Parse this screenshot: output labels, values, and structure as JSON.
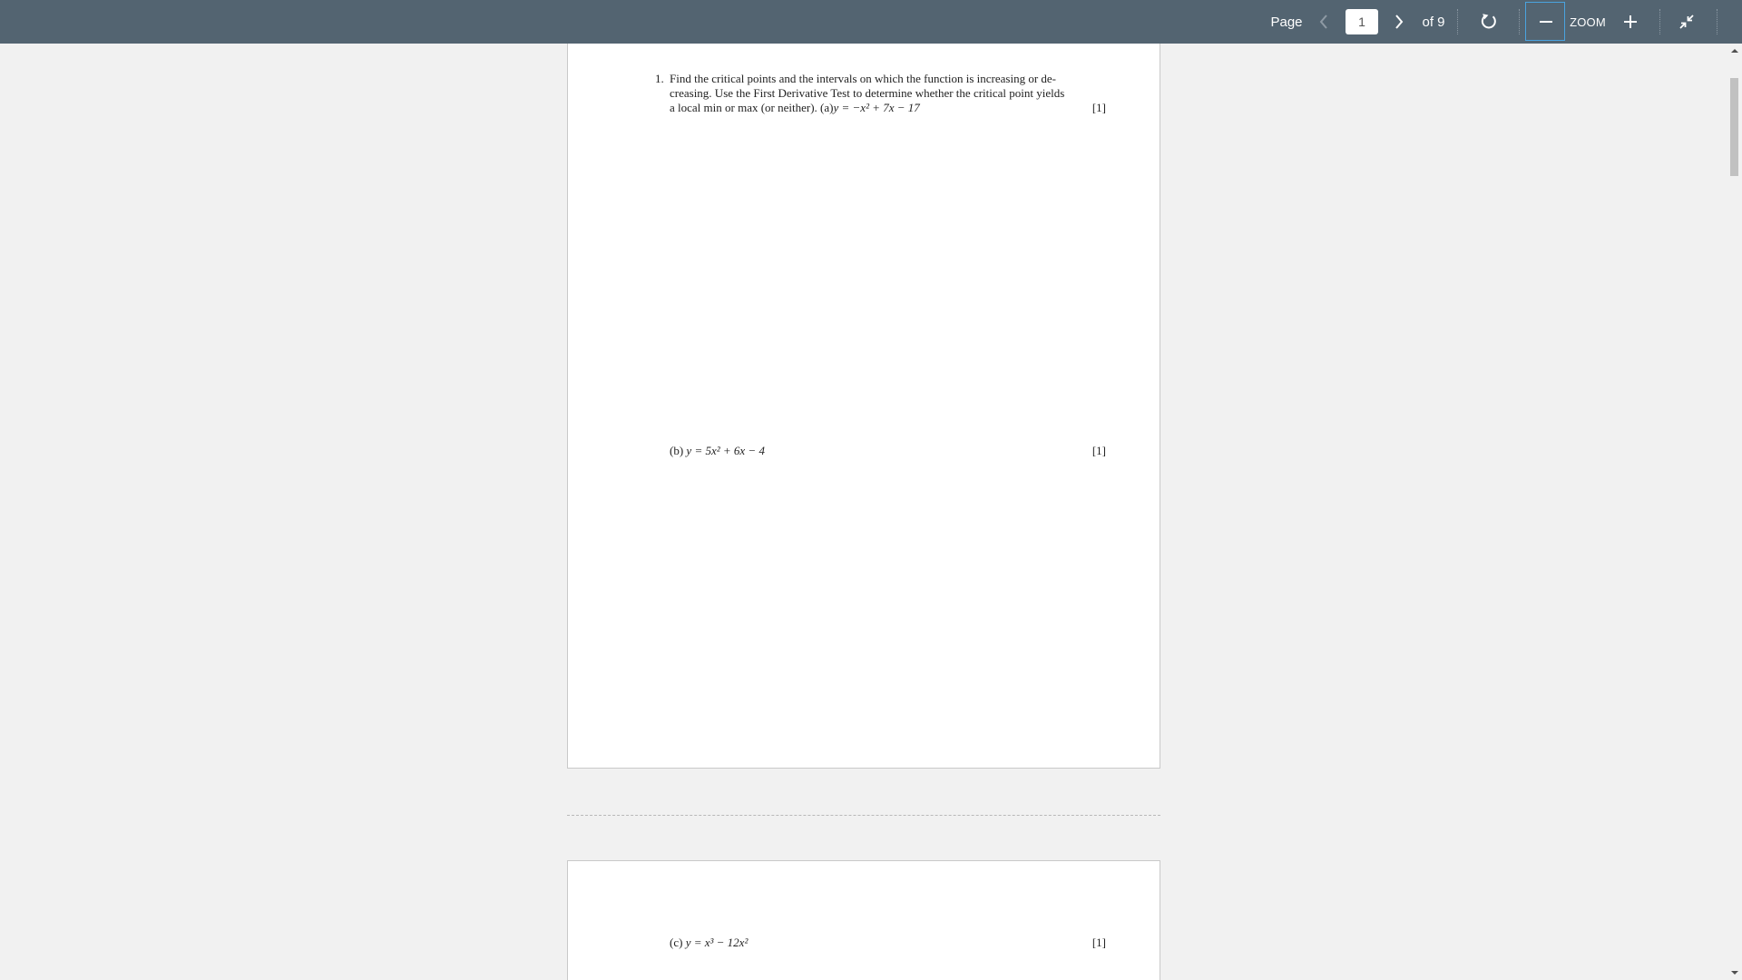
{
  "toolbar": {
    "page_label": "Page",
    "current_page": "1",
    "total_label": "of 9",
    "zoom_label": "ZOOM",
    "icons": {
      "prev": "chevron-left-icon",
      "next": "chevron-right-icon",
      "rotate": "rotate-icon",
      "zoom_out": "minus-icon",
      "zoom_in": "plus-icon",
      "collapse": "collapse-icon"
    },
    "colors": {
      "toolbar_bg": "#536471",
      "focus_border": "#4aa3df"
    }
  },
  "document": {
    "question1": {
      "number": "1.",
      "line1": "Find the critical points and the intervals on which the function is increasing or de-",
      "line2": "creasing. Use the First Derivative Test to determine whether the critical point yields",
      "line3_text": "a local min or max (or neither). (a)",
      "part_a_equation": "y = −x² + 7x − 17",
      "part_a_mark": "[1]",
      "part_b_label": "(b)",
      "part_b_equation": "y = 5x² + 6x − 4",
      "part_b_mark": "[1]"
    },
    "page2": {
      "part_c_label": "(c)",
      "part_c_equation": "y = x³ − 12x²",
      "part_c_mark": "[1]"
    }
  }
}
